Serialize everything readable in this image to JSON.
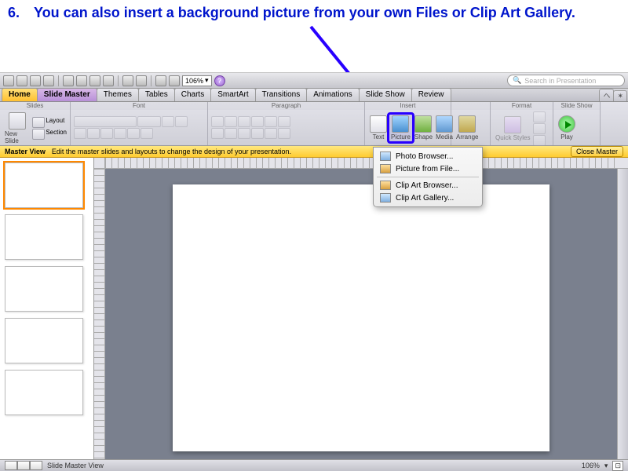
{
  "instruction": {
    "number": "6.",
    "text": "You can also insert a background picture from your own Files or Clip Art Gallery."
  },
  "toolbar": {
    "zoom": "106%",
    "search_placeholder": "Search in Presentation"
  },
  "tabs": [
    "Home",
    "Slide Master",
    "Themes",
    "Tables",
    "Charts",
    "SmartArt",
    "Transitions",
    "Animations",
    "Slide Show",
    "Review"
  ],
  "ribbon": {
    "groups": {
      "slides": "Slides",
      "font": "Font",
      "paragraph": "Paragraph",
      "insert": "Insert",
      "arrange": "Arrange",
      "format": "Format",
      "slideshow": "Slide Show"
    },
    "slides": {
      "new_slide": "New Slide",
      "layout": "Layout",
      "section": "Section"
    },
    "insert": {
      "text": "Text",
      "picture": "Picture",
      "shape": "Shape",
      "media": "Media"
    },
    "arrange_label": "Arrange",
    "format": {
      "quick_styles": "Quick Styles"
    },
    "slideshow": {
      "play": "Play"
    }
  },
  "infobar": {
    "lead": "Master View",
    "text": "Edit the master slides and layouts to change the design of your presentation.",
    "close": "Close Master"
  },
  "dropdown": {
    "items": [
      "Photo Browser...",
      "Picture from File...",
      "Clip Art Browser...",
      "Clip Art Gallery..."
    ]
  },
  "statusbar": {
    "view": "Slide Master View",
    "zoom": "106%"
  }
}
